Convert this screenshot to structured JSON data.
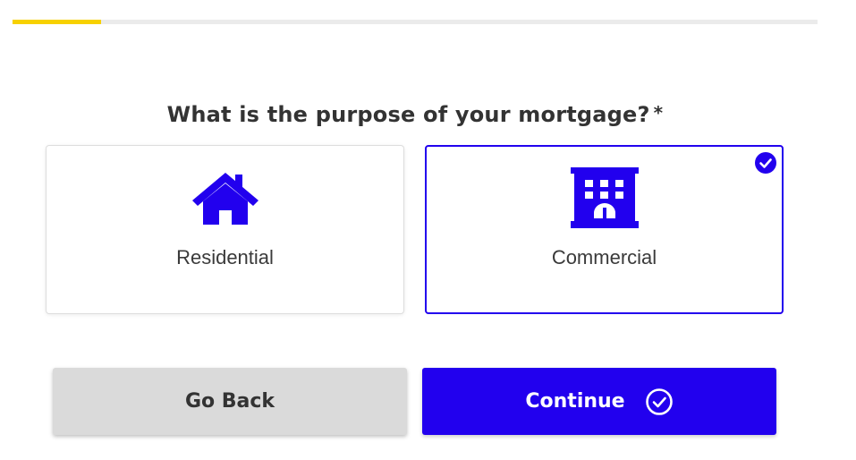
{
  "progress": {
    "fraction": 0.11,
    "color": "#f7d100"
  },
  "question": {
    "text": "What is the purpose of your mortgage?",
    "required_mark": "*"
  },
  "options": [
    {
      "label": "Residential",
      "icon": "house-icon",
      "selected": false
    },
    {
      "label": "Commercial",
      "icon": "building-icon",
      "selected": true
    }
  ],
  "buttons": {
    "back_label": "Go Back",
    "continue_label": "Continue",
    "continue_icon": "check-circle-icon"
  },
  "colors": {
    "accent": "#2200ee",
    "back_button": "#dadada"
  }
}
